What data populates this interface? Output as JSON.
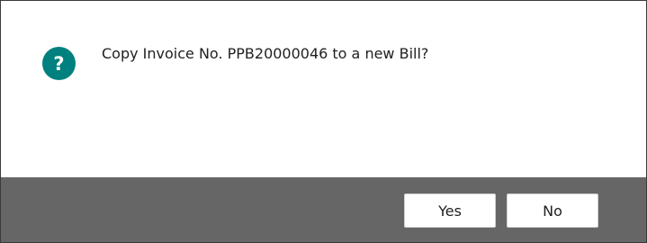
{
  "dialog": {
    "message": "Copy Invoice No. PPB20000046 to a new Bill?",
    "icon": "question-icon",
    "icon_glyph": "?",
    "icon_color": "#00807e",
    "footer_color": "#666666"
  },
  "buttons": {
    "yes_label": "Yes",
    "no_label": "No"
  }
}
